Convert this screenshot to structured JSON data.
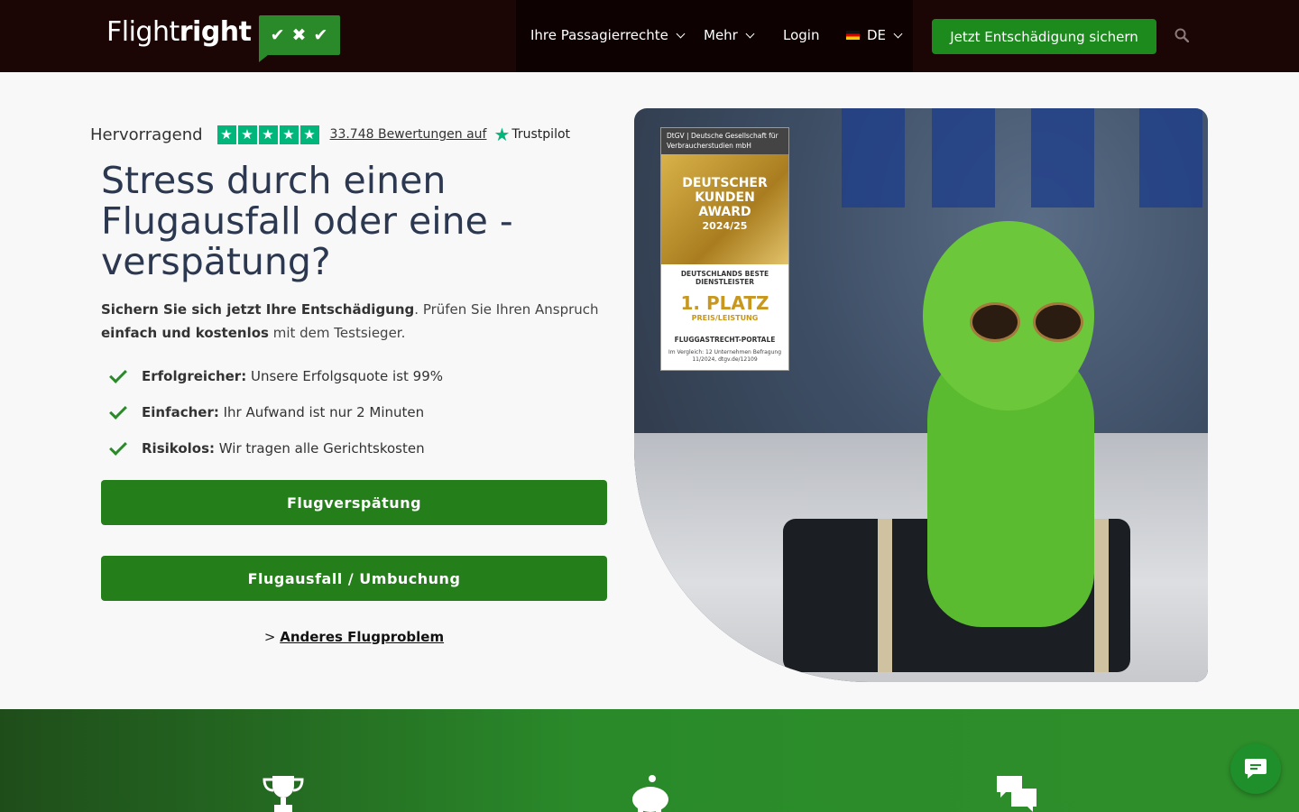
{
  "header": {
    "logo": {
      "part1": "Flight",
      "part2": "right",
      "badge": [
        "✔",
        "✖",
        "✔"
      ]
    },
    "nav": [
      {
        "label": "Ihre Passagierrechte"
      },
      {
        "label": "Mehr"
      },
      {
        "label": "Login"
      },
      {
        "label": "DE"
      }
    ],
    "cta_label": "Jetzt Entschädigung sichern",
    "search_icon": "search-icon"
  },
  "rating": {
    "word": "Hervorragend",
    "stars": 5,
    "reviews_label": "33.748 Bewertungen auf",
    "provider": "Trustpilot",
    "star_color": "#00b67a"
  },
  "hero": {
    "headline": "Stress durch einen Flugausfall oder eine -verspätung?",
    "lead": {
      "b1": "Sichern Sie sich jetzt Ihre Entschädigung",
      "t1": ". Prüfen Sie Ihren Anspruch ",
      "b2": "einfach und kostenlos",
      "t2": " mit dem Testsieger."
    },
    "benefits": [
      {
        "strong": "Erfolgreicher:",
        "text": " Unsere Erfolgsquote ist 99%"
      },
      {
        "strong": "Einfacher:",
        "text": " Ihr Aufwand ist nur 2 Minuten"
      },
      {
        "strong": "Risikolos:",
        "text": " Wir tragen alle Gerichtskosten"
      }
    ],
    "buttons": {
      "delay": "Flugverspätung",
      "cancel": "Flugausfall / Umbuchung"
    },
    "other_prefix": "> ",
    "other_link": "Anderes Flugproblem"
  },
  "award": {
    "org": "DtGV | Deutsche Gesellschaft für Verbraucherstudien mbH",
    "line1": "DEUTSCHER",
    "line2": "KUNDEN",
    "line3": "AWARD",
    "year": "2024/25",
    "sub": "DEUTSCHLANDS BESTE DIENSTLEISTER",
    "place": "1. PLATZ",
    "category_small": "PREIS/LEISTUNG",
    "category": "FLUGGASTRECHT-PORTALE",
    "note": "Im Vergleich: 12 Unternehmen Befragung 11/2024, dtgv.de/12109"
  },
  "colors": {
    "brand_green": "#247f1a",
    "header_bg": "#1c0505",
    "headline": "#2c3850"
  },
  "band_icons": [
    "trophy-icon",
    "piggy-bank-icon",
    "chat-bubbles-icon"
  ],
  "chat_icon": "chat-icon"
}
